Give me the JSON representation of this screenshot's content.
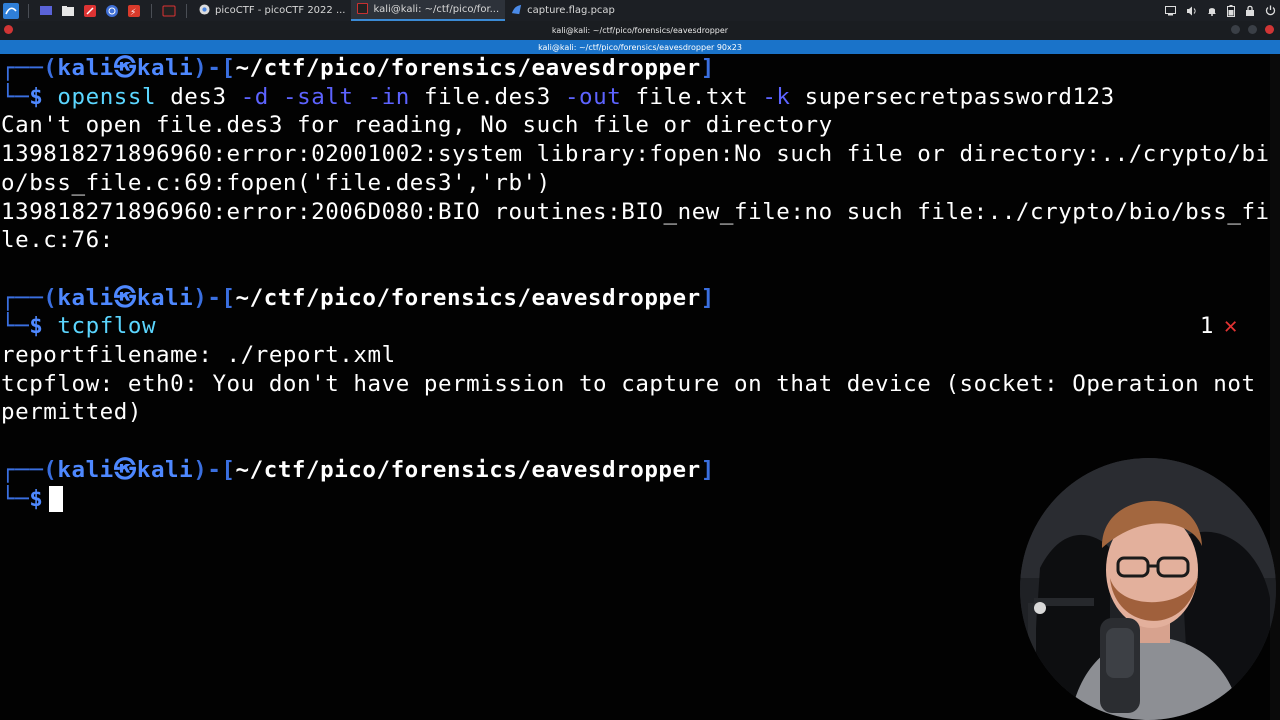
{
  "taskbar": {
    "tasks": [
      {
        "label": "picoCTF - picoCTF 2022 ...",
        "icon": "chrome-icon",
        "active": false
      },
      {
        "label": "kali@kali: ~/ctf/pico/for...",
        "icon": "terminal-icon",
        "active": true
      },
      {
        "label": "capture.flag.pcap",
        "icon": "wireshark-icon",
        "active": false
      }
    ]
  },
  "window": {
    "title": "kali@kali: ~/ctf/pico/forensics/eavesdropper",
    "tab_title": "kali@kali: ~/ctf/pico/forensics/eavesdropper 90x23"
  },
  "terminal": {
    "prompt_user": "kali",
    "prompt_symbol": "㉿",
    "prompt_host": "kali",
    "prompt_dir": "~/ctf/pico/forensics/eavesdropper",
    "prompt_sign": "$",
    "cmd1": {
      "program": "openssl",
      "parts": [
        " des3 ",
        "-d",
        " ",
        "-salt",
        " ",
        "-in",
        " file.des3 ",
        "-out",
        " file.txt ",
        "-k",
        " supersecretpassword123"
      ]
    },
    "output1": [
      "Can't open file.des3 for reading, No such file or directory",
      "139818271896960:error:02001002:system library:fopen:No such file or directory:../crypto/bi",
      "o/bss_file.c:69:fopen('file.des3','rb')",
      "139818271896960:error:2006D080:BIO routines:BIO_new_file:no such file:../crypto/bio/bss_fi",
      "le.c:76:"
    ],
    "cmd2": {
      "program": "tcpflow",
      "exit_code": "1",
      "exit_mark": "✕"
    },
    "output2": [
      "reportfilename: ./report.xml",
      "tcpflow: eth0: You don't have permission to capture on that device (socket: Operation not",
      "permitted)"
    ]
  },
  "colors": {
    "accent": "#1a73c9",
    "prompt": "#3a6fe0",
    "command": "#5bd6ff",
    "option": "#5d63ff",
    "error": "#e23333"
  }
}
